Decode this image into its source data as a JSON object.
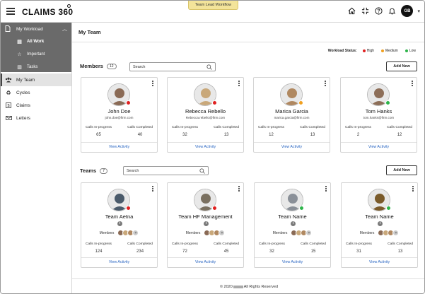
{
  "app": {
    "name": "CLAIMS 360",
    "workflow_label": "Team Lead Workflow",
    "user_initials": "GB"
  },
  "icons": {
    "menu": "hamburger-icon",
    "home": "home-icon",
    "compress": "compress-icon",
    "help": "help-icon",
    "notifications": "bell-icon"
  },
  "sidebar": {
    "workload": {
      "label": "My Workload",
      "items": [
        {
          "label": "All Work",
          "icon": "stack-icon"
        },
        {
          "label": "Important",
          "icon": "star-icon"
        },
        {
          "label": "Tasks",
          "icon": "tasks-icon"
        }
      ]
    },
    "items": [
      {
        "label": "My Team",
        "icon": "team-icon"
      },
      {
        "label": "Cycles",
        "icon": "recycle-icon"
      },
      {
        "label": "Claims",
        "icon": "dollar-icon"
      },
      {
        "label": "Letters",
        "icon": "letters-icon"
      }
    ]
  },
  "page": {
    "title": "My Team",
    "status_label": "Workload Status:",
    "status_legend": [
      {
        "label": "High",
        "color": "#e02020"
      },
      {
        "label": "Medium",
        "color": "#f0a020"
      },
      {
        "label": "Low",
        "color": "#2db44a"
      }
    ]
  },
  "members": {
    "title": "Members",
    "count": "12",
    "search_placeholder": "Search",
    "add_label": "Add New",
    "cards": [
      {
        "name": "John Doe",
        "email": "john.doe@firm.com",
        "calls_in_progress_label": "Calls In-progress",
        "calls_in_progress": "65",
        "calls_completed_label": "Calls Completed",
        "calls_completed": "40",
        "action": "View Activity",
        "status_color": "#e02020",
        "photo_color": "#8a6a55"
      },
      {
        "name": "Rebecca Rebello",
        "email": "Rebecca.rebello@firm.com",
        "calls_in_progress_label": "Calls In-progress",
        "calls_in_progress": "32",
        "calls_completed_label": "Calls Completed",
        "calls_completed": "13",
        "action": "View Activity",
        "status_color": "#e02020",
        "photo_color": "#c9a87a"
      },
      {
        "name": "Marica Garcia",
        "email": "marica.garcia@firm.com",
        "calls_in_progress_label": "Calls In-progress",
        "calls_in_progress": "12",
        "calls_completed_label": "Calls Completed",
        "calls_completed": "13",
        "action": "View Activity",
        "status_color": "#f0a020",
        "photo_color": "#b08860"
      },
      {
        "name": "Tom Hanks",
        "email": "tom.hanks@firm.com",
        "calls_in_progress_label": "Calls In-progress",
        "calls_in_progress": "2",
        "calls_completed_label": "Calls Completed",
        "calls_completed": "12",
        "action": "View Activity",
        "status_color": "#2db44a",
        "photo_color": "#8d6e58"
      }
    ]
  },
  "teams": {
    "title": "Teams",
    "count": "7",
    "search_placeholder": "Search",
    "add_label": "Add New",
    "cards": [
      {
        "name": "Team Aetna",
        "members_label": "Members",
        "calls_in_progress_label": "Calls In-progress",
        "calls_in_progress": "124",
        "calls_completed_label": "Calls Completed",
        "calls_completed": "234",
        "action": "View Activity",
        "status_color": "#e02020",
        "photo_color": "#4a5a6a"
      },
      {
        "name": "Team HF Management",
        "members_label": "Members",
        "calls_in_progress_label": "Calls In-progress",
        "calls_in_progress": "72",
        "calls_completed_label": "Calls Completed",
        "calls_completed": "45",
        "action": "View Activity",
        "status_color": "#e02020",
        "photo_color": "#7a7060"
      },
      {
        "name": "Team Name",
        "members_label": "Members",
        "calls_in_progress_label": "Calls In-progress",
        "calls_in_progress": "32",
        "calls_completed_label": "Calls Completed",
        "calls_completed": "15",
        "action": "View Activity",
        "status_color": "#2db44a",
        "photo_color": "#8a9098"
      },
      {
        "name": "Team Name",
        "members_label": "Members",
        "calls_in_progress_label": "Calls In-progress",
        "calls_in_progress": "31",
        "calls_completed_label": "Calls Completed",
        "calls_completed": "13",
        "action": "View Activity",
        "status_color": "#2db44a",
        "photo_color": "#7a5a2a"
      }
    ]
  },
  "footer": {
    "prefix": "© 2020",
    "suffix": "All Rights Reserved"
  }
}
